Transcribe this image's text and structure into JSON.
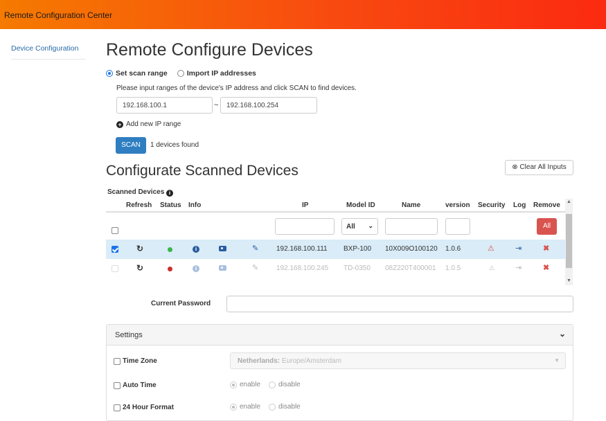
{
  "app": {
    "title": "Remote Configuration Center"
  },
  "sidebar": {
    "items": [
      {
        "label": "Device Configuration"
      }
    ]
  },
  "page": {
    "title": "Remote Configure Devices"
  },
  "scan": {
    "mode_options": [
      {
        "label": "Set scan range",
        "selected": true
      },
      {
        "label": "Import IP addresses",
        "selected": false
      }
    ],
    "hint": "Please input ranges of the device's IP address and click SCAN to find devices.",
    "ip_from": "192.168.100.1",
    "ip_to": "192.168.100.254",
    "range_separator": "~",
    "add_range_label": "Add new IP range",
    "scan_button": "SCAN",
    "found_text": "1 devices found"
  },
  "configure": {
    "title": "Configurate Scanned Devices",
    "clear_button": "Clear All Inputs",
    "clear_icon": "x-circle-icon",
    "scanned_label": "Scanned Devices",
    "columns": [
      "Refresh",
      "Status",
      "Info",
      "IP",
      "Model ID",
      "Name",
      "version",
      "Security",
      "Log",
      "Remove"
    ],
    "model_filter_selected": "All",
    "remove_all_button": "All",
    "rows": [
      {
        "checked": true,
        "status_color": "#3cb44b",
        "ip": "192.168.100.111",
        "model": "BXP-100",
        "name": "10X009O100120",
        "version": "1.0.6",
        "active": true
      },
      {
        "checked": false,
        "status_color": "#c9302c",
        "ip": "192.168.100.245",
        "model": "TD-0350",
        "name": "08Z220T400001",
        "version": "1.0.5",
        "active": false
      }
    ]
  },
  "password": {
    "label": "Current Password",
    "value": ""
  },
  "settings": {
    "title": "Settings",
    "time_zone": {
      "label": "Time Zone",
      "country": "Netherlands:",
      "zone": "Europe/Amsterdam"
    },
    "auto_time": {
      "label": "Auto Time",
      "enable": "enable",
      "disable": "disable"
    },
    "hour24": {
      "label": "24 Hour Format",
      "enable": "enable",
      "disable": "disable"
    }
  }
}
